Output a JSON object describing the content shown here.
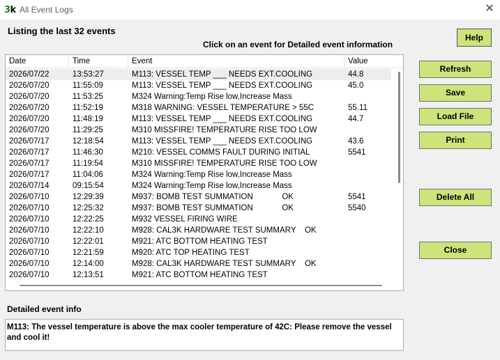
{
  "window": {
    "icon_text_a": "3",
    "icon_text_b": "k",
    "title": "All Event Logs",
    "close_glyph": "✕"
  },
  "heading": "Listing the last 32 events",
  "hint": "Click on an event for Detailed event information",
  "table": {
    "columns": [
      "Date",
      "Time",
      "Event",
      "Value"
    ],
    "rows": [
      {
        "date": "2026/07/22",
        "time": "13:53:27",
        "event": "M113: VESSEL TEMP ___ NEEDS EXT.COOLING",
        "value": "44.8"
      },
      {
        "date": "2026/07/20",
        "time": "11:55:09",
        "event": "M113: VESSEL TEMP ___ NEEDS EXT.COOLING",
        "value": "45.0"
      },
      {
        "date": "2026/07/20",
        "time": "11:53:25",
        "event": "M324 Warning:Temp Rise low,Increase Mass",
        "value": ""
      },
      {
        "date": "2026/07/20",
        "time": "11:52:19",
        "event": "M318 WARNING: VESSEL TEMPERATURE > 55C",
        "value": "55.11"
      },
      {
        "date": "2026/07/20",
        "time": "11:48:19",
        "event": "M113: VESSEL TEMP ___ NEEDS EXT.COOLING",
        "value": "44.7"
      },
      {
        "date": "2026/07/20",
        "time": "11:29:25",
        "event": "M310 MISSFIRE! TEMPERATURE RISE TOO LOW",
        "value": ""
      },
      {
        "date": "2026/07/17",
        "time": "12:18:54",
        "event": "M113: VESSEL TEMP ___ NEEDS EXT.COOLING",
        "value": "43.6"
      },
      {
        "date": "2026/07/17",
        "time": "11:46:30",
        "event": "M210: VESSEL COMMS FAULT DURING INITIAL",
        "value": "5541"
      },
      {
        "date": "2026/07/17",
        "time": "11:19:54",
        "event": "M310 MISSFIRE! TEMPERATURE RISE TOO LOW",
        "value": ""
      },
      {
        "date": "2026/07/17",
        "time": "11:04:06",
        "event": "M324 Warning:Temp Rise low,Increase Mass",
        "value": ""
      },
      {
        "date": "2026/07/14",
        "time": "09:15:54",
        "event": "M324 Warning:Temp Rise low,Increase Mass",
        "value": ""
      },
      {
        "date": "2026/07/10",
        "time": "12:29:39",
        "event": "M937: BOMB TEST SUMMATION             OK",
        "value": "5541"
      },
      {
        "date": "2026/07/10",
        "time": "12:25:32",
        "event": "M937: BOMB TEST SUMMATION             OK",
        "value": "5540"
      },
      {
        "date": "2026/07/10",
        "time": "12:22:25",
        "event": "M932 VESSEL FIRING WIRE",
        "value": ""
      },
      {
        "date": "2026/07/10",
        "time": "12:22:10",
        "event": "M928: CAL3K HARDWARE TEST SUMMARY    OK",
        "value": ""
      },
      {
        "date": "2026/07/10",
        "time": "12:22:01",
        "event": "M921: ATC BOTTOM HEATING TEST",
        "value": ""
      },
      {
        "date": "2026/07/10",
        "time": "12:21:59",
        "event": "M920: ATC TOP HEATING TEST",
        "value": ""
      },
      {
        "date": "2026/07/10",
        "time": "12:14:00",
        "event": "M928: CAL3K HARDWARE TEST SUMMARY    OK",
        "value": ""
      },
      {
        "date": "2026/07/10",
        "time": "12:13:51",
        "event": "M921: ATC BOTTOM HEATING TEST",
        "value": ""
      }
    ]
  },
  "detail": {
    "label": "Detailed event info",
    "text": "M113: The vessel temperature is above the max cooler temperature of 42C: Please remove the vessel and cool it!"
  },
  "buttons": {
    "help": "Help",
    "refresh": "Refresh",
    "save": "Save",
    "load_file": "Load File",
    "print": "Print",
    "delete_all": "Delete All",
    "close": "Close"
  },
  "colors": {
    "button_fill": "#cce47a",
    "icon_green": "#1a8a1a"
  }
}
